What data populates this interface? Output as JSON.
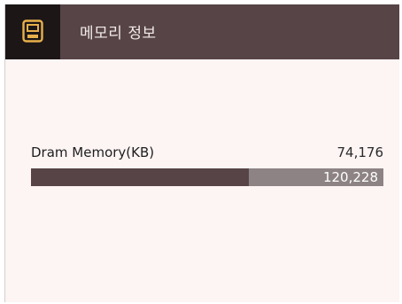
{
  "header": {
    "title": "메모리 정보",
    "icon": "memory-card-icon",
    "icon_color": "#e8b04a"
  },
  "memory": {
    "label": "Dram Memory(KB)",
    "used": "74,176",
    "total": "120,228",
    "used_fraction": 0.617
  },
  "colors": {
    "header_bg": "#574447",
    "icon_box_bg": "#1c1617",
    "bar_fill": "#574447",
    "bar_track": "#8d8385",
    "page_bg": "#fdf4f4"
  }
}
